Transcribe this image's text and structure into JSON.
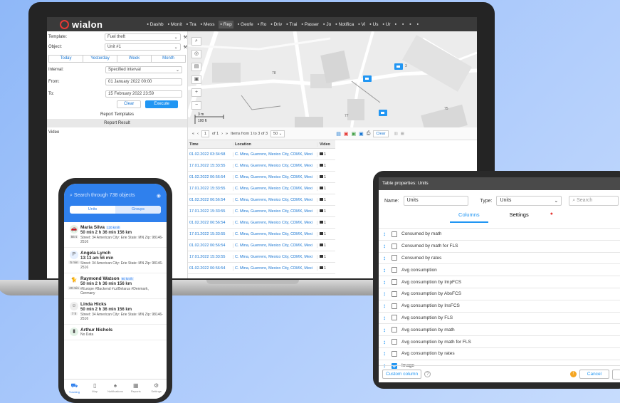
{
  "app": {
    "brand": "wialon",
    "nav": [
      "Dashb",
      "Monit",
      "Tra",
      "Mess",
      "Rep",
      "Geofe",
      "Ro",
      "Driv",
      "Trai",
      "Passer",
      "Jo",
      "Notifica",
      "Vi",
      "Us",
      "Ur",
      "",
      "",
      "",
      ""
    ],
    "active_nav": "Rep"
  },
  "report": {
    "template_label": "Template:",
    "template_value": "Fuel theft",
    "object_label": "Object:",
    "object_value": "Unit #1",
    "periods": [
      "Today",
      "Yesterday",
      "Week",
      "Month"
    ],
    "interval_label": "Interval:",
    "interval_value": "Specified interval",
    "from_label": "From:",
    "from_value": "01 January 2022 00:00",
    "to_label": "To:",
    "to_value": "15 February 2022 23:59",
    "clear": "Clear",
    "execute": "Execute",
    "templates_link": "Report Templates",
    "result_header": "Report Result",
    "video_item": "Video"
  },
  "map": {
    "labels": [
      "78",
      "3",
      "77",
      "75"
    ],
    "scale_top": "3 m",
    "scale_bottom": "100 ft"
  },
  "table_toolbar": {
    "page": "1",
    "of": "of 1",
    "items": "Items from 1 to 3 of 3",
    "per_page": "50",
    "clear": "Clear"
  },
  "table": {
    "headers": [
      "Time",
      "Location",
      "Video"
    ],
    "rows": [
      [
        "01.02.2022 03:34:58",
        "C. Mina, Guerrero, Mexico City, CDMX, Mexi",
        "1"
      ],
      [
        "17.01.2022 15:33:55",
        "C. Mina, Guerrero, Mexico City, CDMX, Mexi",
        "1"
      ],
      [
        "01.02.2022 06:56:54",
        "C. Mina, Guerrero, Mexico City, CDMX, Mexi",
        "1"
      ],
      [
        "17.01.2022 15:33:55",
        "C. Mina, Guerrero, Mexico City, CDMX, Mexi",
        "1"
      ],
      [
        "01.02.2022 06:56:54",
        "C. Mina, Guerrero, Mexico City, CDMX, Mexi",
        "1"
      ],
      [
        "17.01.2022 15:33:55",
        "C. Mina, Guerrero, Mexico City, CDMX, Mexi",
        "1"
      ],
      [
        "01.02.2022 06:56:54",
        "C. Mina, Guerrero, Mexico City, CDMX, Mexi",
        "1"
      ],
      [
        "17.01.2022 15:33:55",
        "C. Mina, Guerrero, Mexico City, CDMX, Mexi",
        "1"
      ],
      [
        "01.02.2022 06:56:54",
        "C. Mina, Guerrero, Mexico City, CDMX, Mexi",
        "1"
      ],
      [
        "17.01.2022 15:33:55",
        "C. Mina, Guerrero, Mexico City, CDMX, Mexi",
        "1"
      ],
      [
        "01.02.2022 06:56:54",
        "C. Mina, Guerrero, Mexico City, CDMX, Mexi",
        "1"
      ]
    ]
  },
  "phone": {
    "search": "Search through 738 objects",
    "seg_units": "Units",
    "seg_groups": "Groups",
    "items": [
      {
        "name": "Maria Silva",
        "speed": "120 km/h",
        "stats": "50 min   2 h 36 min   156 km",
        "addr": "Street: 34 American City: Erie State: MN Zip: 98146-2516",
        "time": "56 s"
      },
      {
        "name": "Angela Lynch",
        "speed": "",
        "stats": "13:13 am   56 min",
        "addr": "Street: 34 American City: Erie State: MN Zip: 98146-2516",
        "time": "5 min"
      },
      {
        "name": "Raymond Watson",
        "speed": "90 km/h",
        "stats": "50 min   2 h 36 min   156 km",
        "addr": "#Europe  #Backend  #cz/Belarus  #Denmark, Germany",
        "time": "20 min"
      },
      {
        "name": "Linda Hicks",
        "speed": "",
        "stats": "50 min   2 h 36 min   156 km",
        "addr": "Street: 34 American City: Erie State: MN Zip: 98146-2516",
        "time": "7 h"
      },
      {
        "name": "Arthur Nichols",
        "speed": "",
        "stats": "",
        "addr": "No Data",
        "time": ""
      }
    ],
    "tabs": [
      "Tracking",
      "Map",
      "Notifications",
      "Reports",
      "Settings"
    ]
  },
  "dialog": {
    "title": "Table properties: Units",
    "name_label": "Name:",
    "name_value": "Units",
    "type_label": "Type:",
    "type_value": "Units",
    "search_placeholder": "Search",
    "tab_columns": "Columns",
    "tab_settings": "Settings",
    "columns": [
      {
        "label": "Consumed by math",
        "checked": false
      },
      {
        "label": "Consumed by math for FLS",
        "checked": false
      },
      {
        "label": "Consumed by rates",
        "checked": false
      },
      {
        "label": "Avg consumption",
        "checked": false
      },
      {
        "label": "Avg consumption by ImpFCS",
        "checked": false
      },
      {
        "label": "Avg consumption by AbsFCS",
        "checked": false
      },
      {
        "label": "Avg consumption by InsFCS",
        "checked": false
      },
      {
        "label": "Avg consumption by FLS",
        "checked": false
      },
      {
        "label": "Avg consumption by math",
        "checked": false
      },
      {
        "label": "Avg consumption by math for FLS",
        "checked": false
      },
      {
        "label": "Avg consumption by rates",
        "checked": false
      },
      {
        "label": "Image",
        "checked": true
      }
    ],
    "custom_column": "Custom column",
    "cancel": "Cancel"
  }
}
